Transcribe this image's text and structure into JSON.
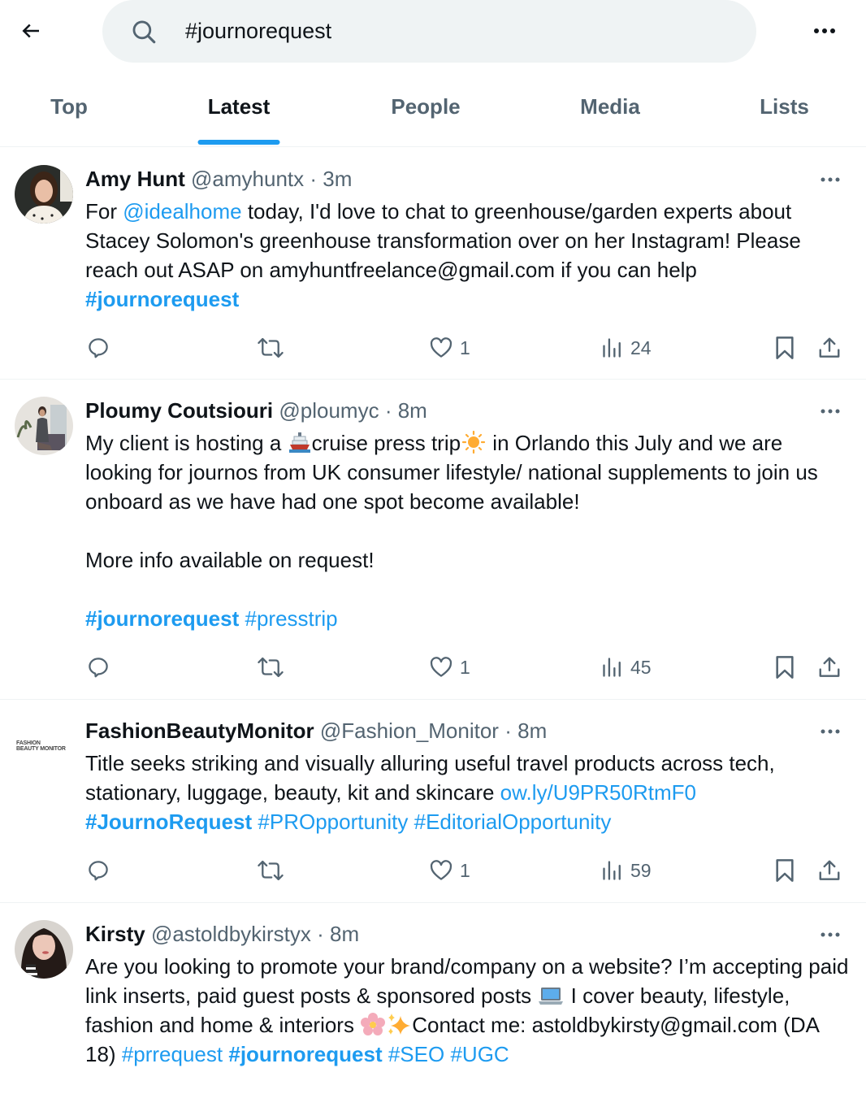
{
  "search": {
    "query": "#journorequest",
    "back_icon": "arrow-left-icon",
    "search_icon": "magnifier-icon",
    "more_icon": "more-horizontal-icon"
  },
  "tabs": [
    {
      "label": "Top",
      "active": false
    },
    {
      "label": "Latest",
      "active": true
    },
    {
      "label": "People",
      "active": false
    },
    {
      "label": "Media",
      "active": false
    },
    {
      "label": "Lists",
      "active": false
    }
  ],
  "colors": {
    "accent": "#1d9bf0",
    "text_primary": "#0f1419",
    "text_secondary": "#536471",
    "search_bg": "#eff3f4"
  },
  "tweets": [
    {
      "name": "Amy Hunt",
      "handle": "@amyhuntx",
      "dot": "·",
      "time": "3m",
      "body": {
        "p1": "For ",
        "mention": "@idealhome",
        "p2": " today, I'd love to chat to greenhouse/garden experts about Stacey Solomon's greenhouse transformation over on her Instagram! Please reach out ASAP on amyhuntfreelance@gmail.com if you can help",
        "tag1": "#journorequest"
      },
      "replies": "",
      "retweets": "",
      "likes": "1",
      "views": "24"
    },
    {
      "name": "Ploumy Coutsiouri",
      "handle": "@ploumyc",
      "dot": "·",
      "time": "8m",
      "body": {
        "p1": "My client is hosting a ",
        "emoji1": "ship-emoji",
        "p2": "cruise press trip",
        "emoji2": "sun-emoji",
        "p3": " in Orlando this July and we are looking for journos from UK consumer lifestyle/ national supplements to join us onboard as we have had one spot become available!",
        "p4": "More info available on request!",
        "tag1": "#journorequest",
        "tag2": "#presstrip"
      },
      "replies": "",
      "retweets": "",
      "likes": "1",
      "views": "45"
    },
    {
      "name": "FashionBeautyMonitor",
      "handle": "@Fashion_Monitor",
      "dot": "·",
      "time": "8m",
      "avatar_text_1": "FASHION",
      "avatar_text_2": "BEAUTY",
      "avatar_text_3": "MONITOR",
      "body": {
        "p1": "Title seeks striking and visually alluring useful travel products across tech, stationary, luggage, beauty, kit and skincare ",
        "link": "ow.ly/U9PR50RtmF0",
        "tag1": "#JournoRequest",
        "tag2": "#PROpportunity",
        "tag3": "#EditorialOpportunity"
      },
      "replies": "",
      "retweets": "",
      "likes": "1",
      "views": "59"
    },
    {
      "name": "Kirsty",
      "handle": "@astoldbykirstyx",
      "dot": "·",
      "time": "8m",
      "body": {
        "p1": "Are you looking to promote your brand/company on a website? I’m accepting paid link inserts, paid guest posts & sponsored posts ",
        "emoji1": "laptop-emoji",
        "p2": " I cover beauty, lifestyle, fashion and home & interiors ",
        "emoji2": "cherry-blossom-emoji",
        "emoji3": "sparkles-emoji",
        "p3": "Contact me: astoldbykirsty@gmail.com (DA 18) ",
        "tag1": "#prrequest",
        "tag2": "#journorequest",
        "tag3": "#SEO",
        "tag4": "#UGC"
      }
    }
  ]
}
